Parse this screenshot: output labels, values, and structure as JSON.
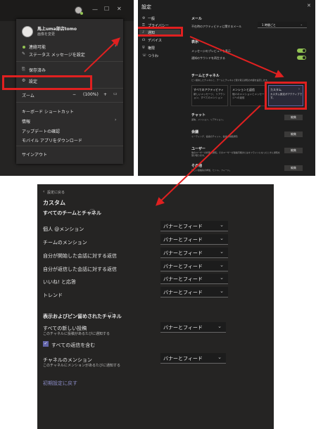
{
  "colors": {
    "accent": "#6264a7",
    "highlight": "#e02020",
    "toggle_on": "#92c353"
  },
  "menu": {
    "user_name": "馬上uma部店tomo",
    "change_image": "画像を変更",
    "status": "連絡可能",
    "status_message": "ステータス メッセージを設定",
    "saved": "保存済み",
    "settings": "設定",
    "zoom_label": "ズーム",
    "zoom_value": "(100%)",
    "zoom_minus": "−",
    "zoom_plus": "+",
    "shortcuts": "キーボード ショートカット",
    "about": "情報",
    "check_updates": "アップデートの確認",
    "mobile_app": "モバイル アプリをダウンロード",
    "sign_out": "サインアウト"
  },
  "settings_window": {
    "title": "設定",
    "nav": [
      {
        "label": "一般",
        "icon": "gear-icon"
      },
      {
        "label": "プライバシー",
        "icon": "lock-icon"
      },
      {
        "label": "通知",
        "icon": "bell-icon"
      },
      {
        "label": "デバイス",
        "icon": "headset-icon"
      },
      {
        "label": "権限",
        "icon": "shield-icon"
      },
      {
        "label": "つうわ",
        "icon": "phone-icon"
      }
    ],
    "email_heading": "メール",
    "email_label": "不在時のアクティビティに関するメール",
    "email_value": "1 時間ごと",
    "display_heading": "表示",
    "preview_label": "メッセージのプレビューを表示",
    "sound_label": "通知のサウンドを再生する",
    "teams_heading": "チームとチャネル",
    "teams_desc": "ピン留めしたチャネルと、チームとチャネルで受け取る通知の内容を設定します。",
    "card1_title": "すべてのアクティビティ",
    "card1_desc": "新しいメッセージ、リアクション、すべてのメンション",
    "card2_title": "メンションと返信",
    "card2_desc": "個人のメンションとメッセージへの返信",
    "card3_title": "カスタム",
    "card3_desc": "カスタム設定がアクティブです。",
    "chat_heading": "チャット",
    "chat_desc": "返信、メンション、リアクション。",
    "meeting_heading": "会議",
    "meeting_desc": "ミーティング、会議のチャット、会議の開始通知",
    "user_heading": "ユーザー",
    "user_desc": "他のユーザーの状態の通知。そのユーザーが連絡可能またはオフラインになったときに通知を受け取ります。",
    "other_heading": "その他",
    "other_desc": "新しい連絡先の参加、ヒント、フィード。",
    "edit": "編集"
  },
  "custom": {
    "back": "設定に戻る",
    "title": "カスタム",
    "section1": "すべてのチームとチャネル",
    "rows": [
      {
        "label": "個人 @メンション",
        "value": "バナーとフィード"
      },
      {
        "label": "チームのメンション",
        "value": "バナーとフィード"
      },
      {
        "label": "自分が開始した会話に対する返信",
        "value": "バナーとフィード"
      },
      {
        "label": "自分が返信した会話に対する返信",
        "value": "バナーとフィード"
      },
      {
        "label": "いいね! と応答",
        "value": "バナーとフィード"
      },
      {
        "label": "トレンド",
        "value": "バナーとフィード"
      }
    ],
    "section2": "表示およびピン留めされたチャネル",
    "all_posts_label": "すべての新しい投稿",
    "all_posts_desc": "このチャネルに投稿があるたびに通知する",
    "all_posts_value": "バナーとフィード",
    "include_replies": "すべての返信を含む",
    "include_replies_checked": true,
    "channel_mention_label": "チャネルのメンション",
    "channel_mention_desc": "このチャネルにメンションがあるたびに通知する",
    "channel_mention_value": "バナーとフィード",
    "reset": "初期設定に戻す"
  }
}
